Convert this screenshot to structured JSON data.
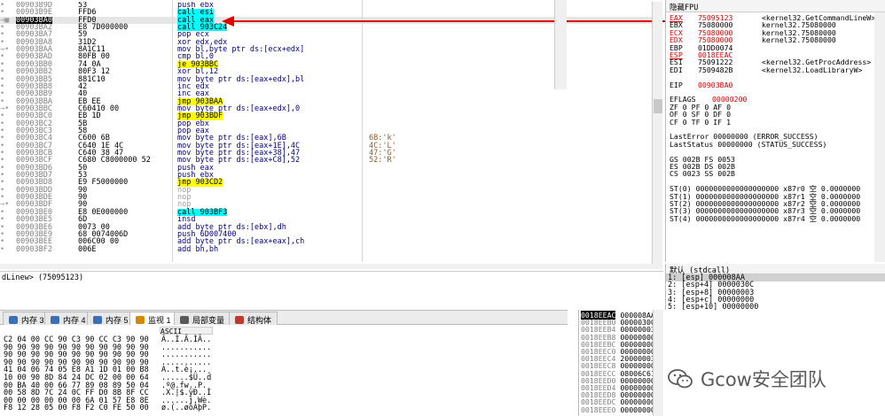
{
  "disasm": [
    {
      "addr": "00903B9D",
      "bytes": "53",
      "ins": "push ebx",
      "type": "push",
      "gut": "•"
    },
    {
      "addr": "00903B9E",
      "bytes": "FFD6",
      "ins": "call esi",
      "type": "call",
      "gut": "•"
    },
    {
      "addr": "00903BA0",
      "bytes": "FFD0",
      "ins": "call eax",
      "type": "call",
      "gut": "→■",
      "selected": true
    },
    {
      "addr": "00903BA2",
      "bytes": "E8 7D000000",
      "ins": "call 903C24",
      "type": "call",
      "gut": "•"
    },
    {
      "addr": "00903BA7",
      "bytes": "59",
      "ins": "pop ecx",
      "type": "plain",
      "gut": "•"
    },
    {
      "addr": "00903BA8",
      "bytes": "31D2",
      "ins": "xor edx,edx",
      "type": "plain",
      "gut": "•"
    },
    {
      "addr": "00903BAA",
      "bytes": "8A1C11",
      "ins": "mov bl,byte ptr ds:[ecx+edx]",
      "type": "plain",
      "gut": "→•"
    },
    {
      "addr": "00903BAD",
      "bytes": "80FB 00",
      "ins": "cmp bl,0",
      "type": "plain",
      "gut": "•"
    },
    {
      "addr": "00903BB0",
      "bytes": "74 0A",
      "ins": "je 903BBC",
      "type": "jmp",
      "gut": "•"
    },
    {
      "addr": "00903BB2",
      "bytes": "80F3 12",
      "ins": "xor bl,12",
      "type": "plain",
      "gut": "•"
    },
    {
      "addr": "00903BB5",
      "bytes": "881C10",
      "ins": "mov byte ptr ds:[eax+edx],bl",
      "type": "plain",
      "gut": "•"
    },
    {
      "addr": "00903BB8",
      "bytes": "42",
      "ins": "inc edx",
      "type": "plain",
      "gut": "•"
    },
    {
      "addr": "00903BB9",
      "bytes": "40",
      "ins": "inc eax",
      "type": "plain",
      "gut": "•"
    },
    {
      "addr": "00903BBA",
      "bytes": "EB EE",
      "ins": "jmp 903BAA",
      "type": "jmp",
      "gut": "•"
    },
    {
      "addr": "00903BBC",
      "bytes": "C60410 00",
      "ins": "mov byte ptr ds:[eax+edx],0",
      "type": "plain",
      "gut": "→•"
    },
    {
      "addr": "00903BC0",
      "bytes": "EB 1D",
      "ins": "jmp 903BDF",
      "type": "jmp",
      "gut": "•"
    },
    {
      "addr": "00903BC2",
      "bytes": "5B",
      "ins": "pop ebx",
      "type": "plain",
      "gut": "•"
    },
    {
      "addr": "00903BC3",
      "bytes": "58",
      "ins": "pop eax",
      "type": "plain",
      "gut": "•"
    },
    {
      "addr": "00903BC4",
      "bytes": "C600 6B",
      "ins": "mov byte ptr ds:[eax],6B",
      "type": "plain",
      "cmt": "6B:'k'",
      "gut": "•"
    },
    {
      "addr": "00903BC7",
      "bytes": "C640 1E 4C",
      "ins": "mov byte ptr ds:[eax+1E],4C",
      "type": "plain",
      "cmt": "4C:'L'",
      "gut": "•"
    },
    {
      "addr": "00903BCB",
      "bytes": "C640 38 47",
      "ins": "mov byte ptr ds:[eax+38],47",
      "type": "plain",
      "cmt": "47:'G'",
      "gut": "•"
    },
    {
      "addr": "00903BCF",
      "bytes": "C680 C8000000 52",
      "ins": "mov byte ptr ds:[eax+C8],52",
      "type": "plain",
      "cmt": "52:'R'",
      "gut": "•"
    },
    {
      "addr": "00903BD6",
      "bytes": "50",
      "ins": "push eax",
      "type": "push",
      "gut": "•"
    },
    {
      "addr": "00903BD7",
      "bytes": "53",
      "ins": "push ebx",
      "type": "push",
      "gut": "•"
    },
    {
      "addr": "00903BD8",
      "bytes": "E9 F5000000",
      "ins": "jmp 903CD2",
      "type": "jmp",
      "gut": "•"
    },
    {
      "addr": "00903BDD",
      "bytes": "90",
      "ins": "nop",
      "type": "nop",
      "gut": "•"
    },
    {
      "addr": "00903BDE",
      "bytes": "90",
      "ins": "nop",
      "type": "nop",
      "gut": "•"
    },
    {
      "addr": "00903BDF",
      "bytes": "90",
      "ins": "nop",
      "type": "nop",
      "gut": "→•"
    },
    {
      "addr": "00903BE0",
      "bytes": "E8 0E000000",
      "ins": "call 903BF3",
      "type": "call",
      "gut": "•"
    },
    {
      "addr": "00903BE5",
      "bytes": "6D",
      "ins": "insd",
      "type": "plain",
      "gut": "•"
    },
    {
      "addr": "00903BE6",
      "bytes": "0073 00",
      "ins": "add byte ptr ds:[ebx],dh",
      "type": "plain",
      "gut": "•"
    },
    {
      "addr": "00903BE9",
      "bytes": "68 0074006D",
      "ins": "push 6D007400",
      "type": "push",
      "gut": "•"
    },
    {
      "addr": "00903BEE",
      "bytes": "006C00 00",
      "ins": "add byte ptr ds:[eax+eax],ch",
      "type": "plain",
      "gut": "•"
    },
    {
      "addr": "00903BF2",
      "bytes": "006E",
      "ins": "add bh,bh",
      "type": "plain",
      "gut": "•"
    }
  ],
  "registers": {
    "title": "隐藏FPU",
    "gp": [
      {
        "name": "EAX",
        "val": "75095123",
        "cmt": "<kernel32.GetCommandLineW>",
        "red": true,
        "ul": true
      },
      {
        "name": "EBX",
        "val": "75080000",
        "cmt": "kernel32.75080000",
        "red": false
      },
      {
        "name": "ECX",
        "val": "75080000",
        "cmt": "kernel32.75080000",
        "red": true
      },
      {
        "name": "EDX",
        "val": "75080000",
        "cmt": "kernel32.75080000",
        "red": true
      },
      {
        "name": "EBP",
        "val": "01DD0074",
        "cmt": "",
        "red": false
      },
      {
        "name": "ESP",
        "val": "0018EEAC",
        "cmt": "",
        "red": true,
        "ul": true
      },
      {
        "name": "ESI",
        "val": "75091222",
        "cmt": "<kernel32.GetProcAddress>",
        "red": false
      },
      {
        "name": "EDI",
        "val": "7509482B",
        "cmt": "<kernel32.LoadLibraryW>",
        "red": false
      }
    ],
    "eip": {
      "name": "EIP",
      "val": "00903BA0"
    },
    "eflags": {
      "name": "EFLAGS",
      "val": "00000200"
    },
    "flags": [
      "ZF 0  PF 0  AF 0",
      "OF 0  SF 0  DF 0",
      "CF 0  TF 0  IF 1"
    ],
    "last_error": "LastError  00000000 (ERROR_SUCCESS)",
    "last_status": "LastStatus 00000000 (STATUS_SUCCESS)",
    "segs": [
      "GS 002B  FS 0053",
      "ES 002B  DS 002B",
      "CS 0023  SS 002B"
    ],
    "fpu": [
      "ST(0) 0000000000000000000 x87r0 空 0.0000000",
      "ST(1) 0000000000000000000 x87r1 空 0.0000000",
      "ST(2) 0000000000000000000 x87r2 空 0.0000000",
      "ST(3) 0000000000000000000 x87r3 空 0.0000000",
      "ST(4) 0000000000000000000 x87r4 空 0.0000000"
    ]
  },
  "status_line": "dLinew> (75095123)",
  "stackcall": {
    "title": "默认 (stdcall)",
    "rows": [
      "1: [esp]  000008AA",
      "2: [esp+4]  0000030C",
      "3: [esp+8]  00000003",
      "4: [esp+c]  00000000",
      "5: [esp+10] 00000000"
    ]
  },
  "tabs": [
    {
      "label": "内存 3",
      "icon": "memory-icon"
    },
    {
      "label": "内存 4",
      "icon": "memory-icon"
    },
    {
      "label": "内存 5",
      "icon": "memory-icon"
    },
    {
      "label": "监视 1",
      "icon": "watch-icon"
    },
    {
      "label": "局部变量",
      "icon": "locals-icon"
    },
    {
      "label": "结构体",
      "icon": "struct-icon"
    }
  ],
  "dump": {
    "ascii_header": "ASCII",
    "rows": [
      {
        "hex": "C2 04 00 CC 90 C3 90 CC C3 90 90",
        "asc": "Â..Ì.Ã.ÌÃ.."
      },
      {
        "hex": "90 90 90 90 90 90 90 90 90 90 90",
        "asc": "..........."
      },
      {
        "hex": "90 90 90 90 90 90 90 90 90 90 90",
        "asc": "..........."
      },
      {
        "hex": "90 90 90 90 90 90 90 90 90 90 90",
        "asc": "..........."
      },
      {
        "hex": "41 04 06 74 05 E8 A1 1D 01 00 B8",
        "asc": "A..t.è¡...¸"
      },
      {
        "hex": "10 00 90 8D 84 24 DC 02 00 00 64",
        "asc": "......$Ü..d"
      },
      {
        "hex": "00 BA 40 00 66 77 89 08 89 50 04",
        "asc": ".º@.fw..P."
      },
      {
        "hex": "00 58 8D 7C 24 0C FF D0 8B 8F CC",
        "asc": ".X.|$.ÿÐ..Ì"
      },
      {
        "hex": "00 00 00 00 00 00 6A 01 57 E8 8E",
        "asc": "......j.Wè."
      },
      {
        "hex": "F8 12 28 05 00 F8 F2 C0 FE 50 00",
        "asc": "ø.(..øòÀþP."
      }
    ]
  },
  "stack": {
    "rows": [
      {
        "addr": "0018EEAC",
        "val": "000008AA",
        "sel": true
      },
      {
        "addr": "0018EEB0",
        "val": "0000030C"
      },
      {
        "addr": "0018EEB4",
        "val": "00000003"
      },
      {
        "addr": "0018EEB8",
        "val": "00000000"
      },
      {
        "addr": "0018EEBC",
        "val": "00000000"
      },
      {
        "addr": "0018EEC0",
        "val": "00000000"
      },
      {
        "addr": "0018EEC4",
        "val": "20000003"
      },
      {
        "addr": "0018EEC8",
        "val": "00000000"
      },
      {
        "addr": "0018EECC",
        "val": "08006C61"
      },
      {
        "addr": "0018EED0",
        "val": "00000000"
      },
      {
        "addr": "0018EED4",
        "val": "00000000"
      },
      {
        "addr": "0018EED8",
        "val": "00000000"
      },
      {
        "addr": "0018EEDC",
        "val": "00000000"
      },
      {
        "addr": "0018EEE0",
        "val": "00000000"
      }
    ]
  },
  "watermark": "Gcow安全团队",
  "colors": {
    "jmp": "#ffff00",
    "call": "#00ffff",
    "arrow": "#e00000",
    "reg_changed": "#e00000"
  }
}
